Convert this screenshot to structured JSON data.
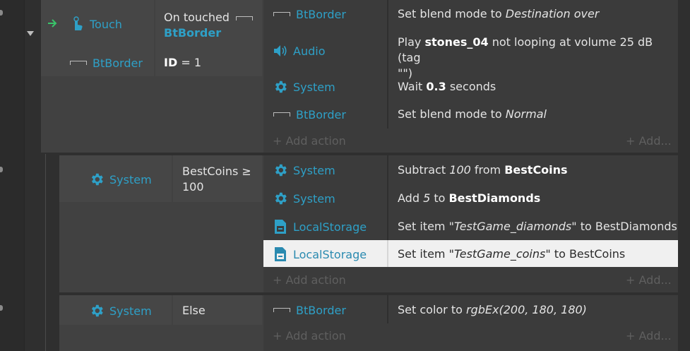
{
  "colors": {
    "object_blue": "#2ea0c7",
    "arrow_green": "#39c46a",
    "selected_row_bg": "#f0f0f0"
  },
  "event1": {
    "conditions": [
      {
        "object": "Touch",
        "text": "On touched",
        "param": "BtBorder",
        "icon": "touch-hand-icon",
        "trigger_icon": "trigger-arrow-icon"
      },
      {
        "object": "BtBorder",
        "text": "ID",
        "suffix": "= 1",
        "icon": "sprite-icon"
      }
    ],
    "actions": [
      {
        "object": "BtBorder",
        "icon": "sprite-icon",
        "pre": "Set blend mode to ",
        "em": "Destination over"
      },
      {
        "object": "Audio",
        "icon": "speaker-icon",
        "line1_pre": "Play ",
        "bold": "stones_04",
        "line1_post": " not looping at volume 25 dB (tag",
        "line2": "\"\")"
      },
      {
        "object": "System",
        "icon": "gear-icon",
        "pre": "Wait ",
        "bold": "0.3",
        "post": " seconds"
      },
      {
        "object": "BtBorder",
        "icon": "sprite-icon",
        "pre": "Set blend mode to ",
        "em": "Normal"
      }
    ],
    "add_action": "+ Add action",
    "add_more": "+ Add..."
  },
  "event2": {
    "condition": {
      "object": "System",
      "icon": "gear-icon",
      "line1": "BestCoins ≥",
      "line2": "100"
    },
    "actions": [
      {
        "object": "System",
        "icon": "gear-icon",
        "pre": "Subtract ",
        "em": "100",
        "mid": " from ",
        "bold": "BestCoins"
      },
      {
        "object": "System",
        "icon": "gear-icon",
        "pre": "Add ",
        "em": "5",
        "mid": " to ",
        "bold": "BestDiamonds"
      },
      {
        "object": "LocalStorage",
        "icon": "storage-icon",
        "pre": "Set item \"",
        "em": "TestGame_diamonds",
        "post": "\" to BestDiamonds"
      },
      {
        "object": "LocalStorage",
        "icon": "storage-icon",
        "pre": "Set item \"",
        "em": "TestGame_coins",
        "post": "\" to BestCoins",
        "selected": true
      }
    ],
    "add_action": "+ Add action",
    "add_more": "+ Add..."
  },
  "event3": {
    "condition": {
      "object": "System",
      "icon": "gear-icon",
      "text": "Else"
    },
    "actions": [
      {
        "object": "BtBorder",
        "icon": "sprite-icon",
        "pre": "Set color to ",
        "em": "rgbEx(200, 180, 180)"
      }
    ],
    "add_action": "+ Add action",
    "add_more": "+ Add..."
  }
}
